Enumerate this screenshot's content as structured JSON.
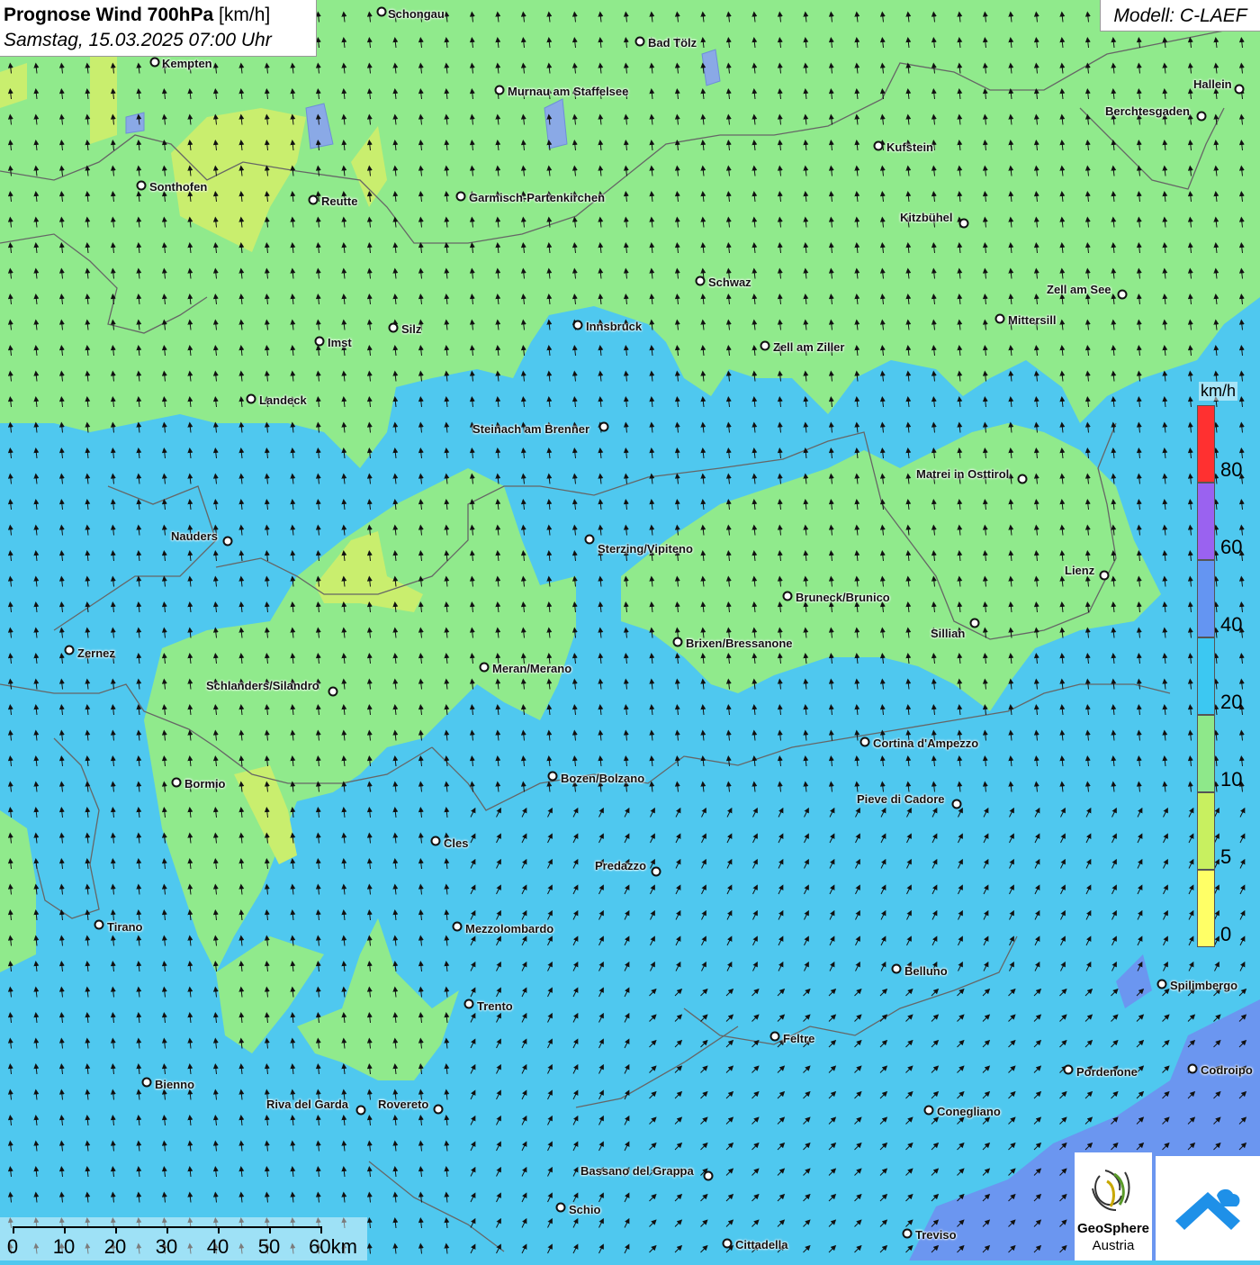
{
  "title": {
    "main": "Prognose Wind 700hPa",
    "unit": "[km/h]",
    "subtitle": "Samstag, 15.03.2025 07:00 Uhr"
  },
  "model": "Modell: C-LAEF",
  "legend": {
    "unit": "km/h",
    "ticks": [
      "80",
      "60",
      "40",
      "20",
      "10",
      "5",
      "0"
    ],
    "colors": [
      "#ff3030",
      "#9a62f0",
      "#6495f2",
      "#3cc8f2",
      "#8ee88a",
      "#c8f060",
      "#ffff66"
    ]
  },
  "scale_bar": {
    "labels": [
      "0",
      "10",
      "20",
      "30",
      "40",
      "50",
      "60km"
    ]
  },
  "logos": {
    "geosphere_line1": "GeoSphere",
    "geosphere_line2": "Austria"
  },
  "colors": {
    "wind_0_10": "#90ea8c",
    "wind_5_10_yellow": "#c9ee6e",
    "wind_10_20": "#4fc8ef",
    "wind_20_40": "#6b96f0"
  },
  "cities": [
    {
      "name": "Schongau"
    },
    {
      "name": "Bad Tölz"
    },
    {
      "name": "Kempten"
    },
    {
      "name": "Murnau am Staffelsee"
    },
    {
      "name": "Hallein"
    },
    {
      "name": "Berchtesgaden"
    },
    {
      "name": "Kufstein"
    },
    {
      "name": "Sonthofen"
    },
    {
      "name": "Reutte"
    },
    {
      "name": "Garmisch-Partenkirchen"
    },
    {
      "name": "Kitzbühel"
    },
    {
      "name": "Schwaz"
    },
    {
      "name": "Zell am See"
    },
    {
      "name": "Mittersill"
    },
    {
      "name": "Innsbruck"
    },
    {
      "name": "Silz"
    },
    {
      "name": "Imst"
    },
    {
      "name": "Zell am Ziller"
    },
    {
      "name": "Landeck"
    },
    {
      "name": "Steinach am Brenner"
    },
    {
      "name": "Matrei in Osttirol"
    },
    {
      "name": "Nauders"
    },
    {
      "name": "Sterzing/Vipiteno"
    },
    {
      "name": "Lienz"
    },
    {
      "name": "Bruneck/Brunico"
    },
    {
      "name": "Sillian"
    },
    {
      "name": "Zernez"
    },
    {
      "name": "Brixen/Bressanone"
    },
    {
      "name": "Meran/Merano"
    },
    {
      "name": "Schlanders/Silandro"
    },
    {
      "name": "Cortina d'Ampezzo"
    },
    {
      "name": "Bozen/Bolzano"
    },
    {
      "name": "Bormio"
    },
    {
      "name": "Pieve di Cadore"
    },
    {
      "name": "Cles"
    },
    {
      "name": "Predazzo"
    },
    {
      "name": "Tirano"
    },
    {
      "name": "Mezzolombardo"
    },
    {
      "name": "Belluno"
    },
    {
      "name": "Spilimbergo"
    },
    {
      "name": "Trento"
    },
    {
      "name": "Feltre"
    },
    {
      "name": "Pordenone"
    },
    {
      "name": "Codroipo"
    },
    {
      "name": "Bienno"
    },
    {
      "name": "Riva del Garda"
    },
    {
      "name": "Rovereto"
    },
    {
      "name": "Conegliano"
    },
    {
      "name": "Bassano del Grappa"
    },
    {
      "name": "Schio"
    },
    {
      "name": "Treviso"
    },
    {
      "name": "Cittadella"
    }
  ]
}
